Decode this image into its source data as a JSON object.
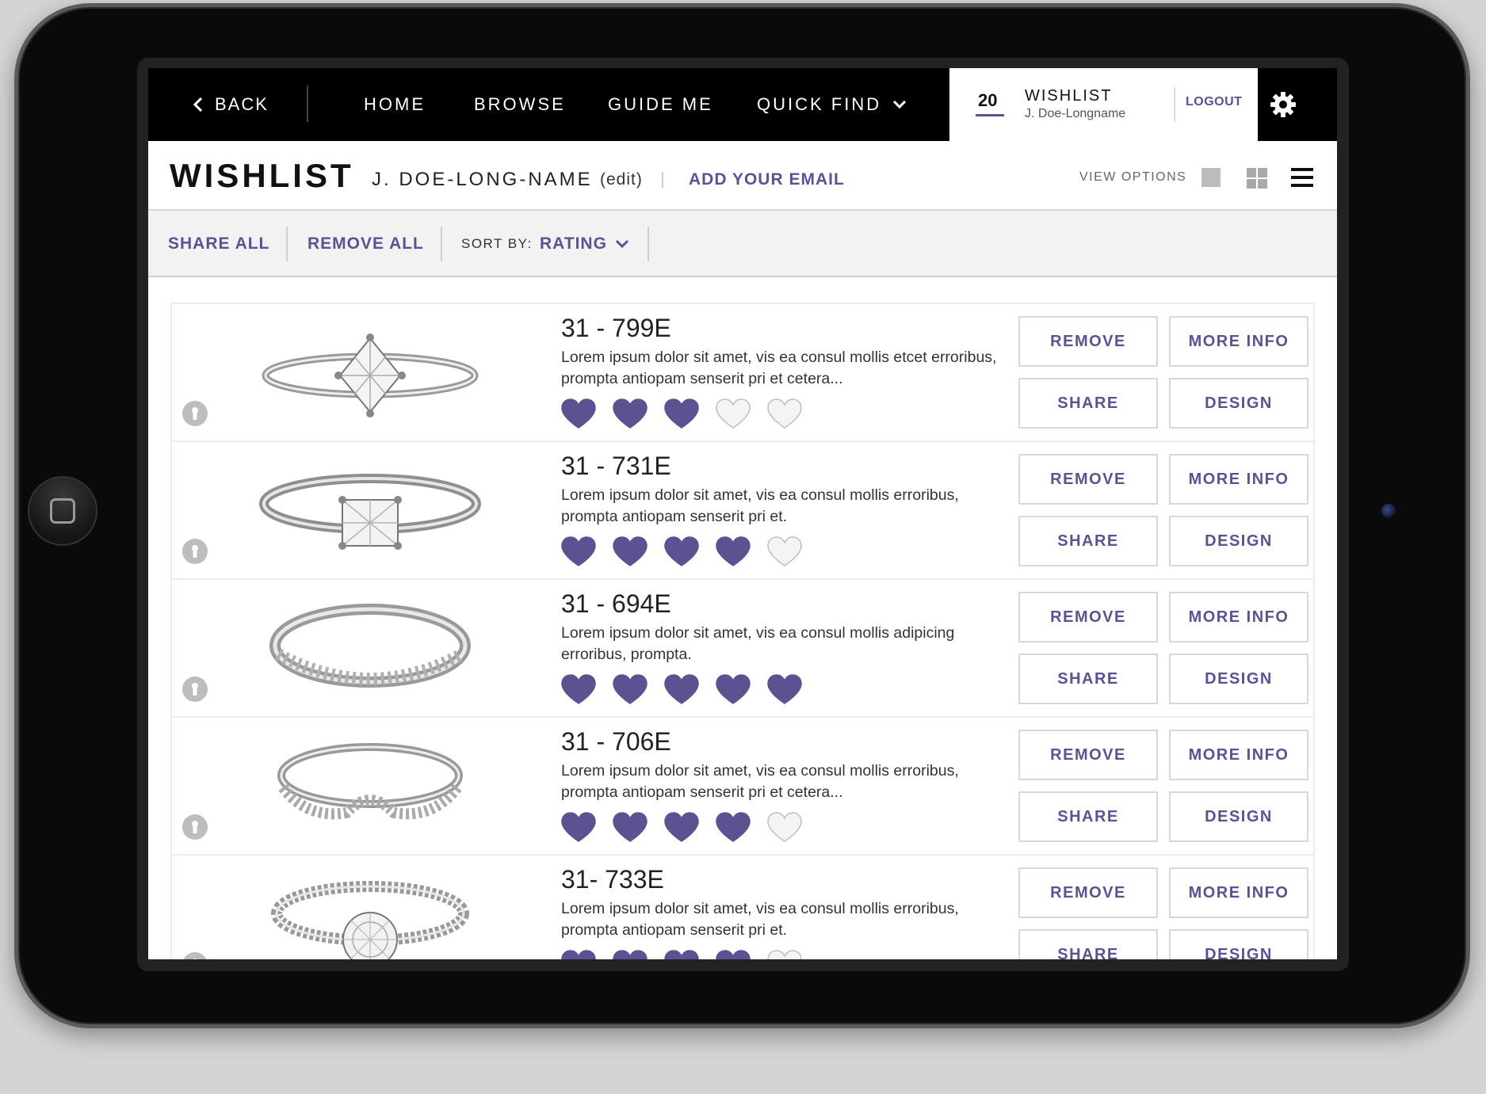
{
  "colors": {
    "accent": "#5b5292",
    "nav_bg": "#000000",
    "toolbar_bg": "#f2f2f2",
    "heart_empty": "#f4f4f4"
  },
  "nav": {
    "back_label": "BACK",
    "items": [
      {
        "label": "HOME"
      },
      {
        "label": "BROWSE"
      },
      {
        "label": "GUIDE ME"
      },
      {
        "label": "QUICK FIND",
        "dropdown": true
      }
    ],
    "wishlist": {
      "count": "20",
      "title": "WISHLIST",
      "user": "J. Doe-Longname",
      "logout": "LOGOUT"
    },
    "settings_icon": "gear-icon"
  },
  "header": {
    "title": "WISHLIST",
    "user_name": "J. DOE-LONG-NAME",
    "edit": "(edit)",
    "add_email": "ADD YOUR EMAIL",
    "view_options_label": "VIEW OPTIONS",
    "view_modes": [
      "single-view-icon",
      "grid-view-icon",
      "list-view-icon"
    ]
  },
  "toolbar": {
    "share_all": "SHARE ALL",
    "remove_all": "REMOVE ALL",
    "sort_label": "SORT BY:",
    "sort_value": "RATING"
  },
  "buttons": {
    "remove": "REMOVE",
    "more_info": "MORE INFO",
    "share": "SHARE",
    "design": "DESIGN"
  },
  "items": [
    {
      "sku": "31 - 799E",
      "description": "Lorem ipsum dolor sit amet, vis ea consul mollis etcet erroribus, prompta antiopam senserit pri et cetera...",
      "rating": 3,
      "max_rating": 5,
      "ring_style": "solitaire-princess"
    },
    {
      "sku": "31 - 731E",
      "description": "Lorem ipsum dolor sit amet, vis ea consul mollis erroribus, prompta antiopam senserit pri et.",
      "rating": 4,
      "max_rating": 5,
      "ring_style": "cathedral-princess"
    },
    {
      "sku": "31 - 694E",
      "description": "Lorem ipsum dolor sit amet, vis ea consul mollis adipicing erroribus, prompta.",
      "rating": 5,
      "max_rating": 5,
      "ring_style": "pave-band"
    },
    {
      "sku": "31 - 706E",
      "description": "Lorem ipsum dolor sit amet, vis ea consul mollis erroribus, prompta antiopam senserit pri et cetera...",
      "rating": 4,
      "max_rating": 5,
      "ring_style": "curved-pave-band"
    },
    {
      "sku": "31- 733E",
      "description": "Lorem ipsum dolor sit amet, vis ea consul mollis erroribus, prompta antiopam senserit pri et.",
      "rating": 4,
      "max_rating": 5,
      "ring_style": "halo-round"
    }
  ]
}
